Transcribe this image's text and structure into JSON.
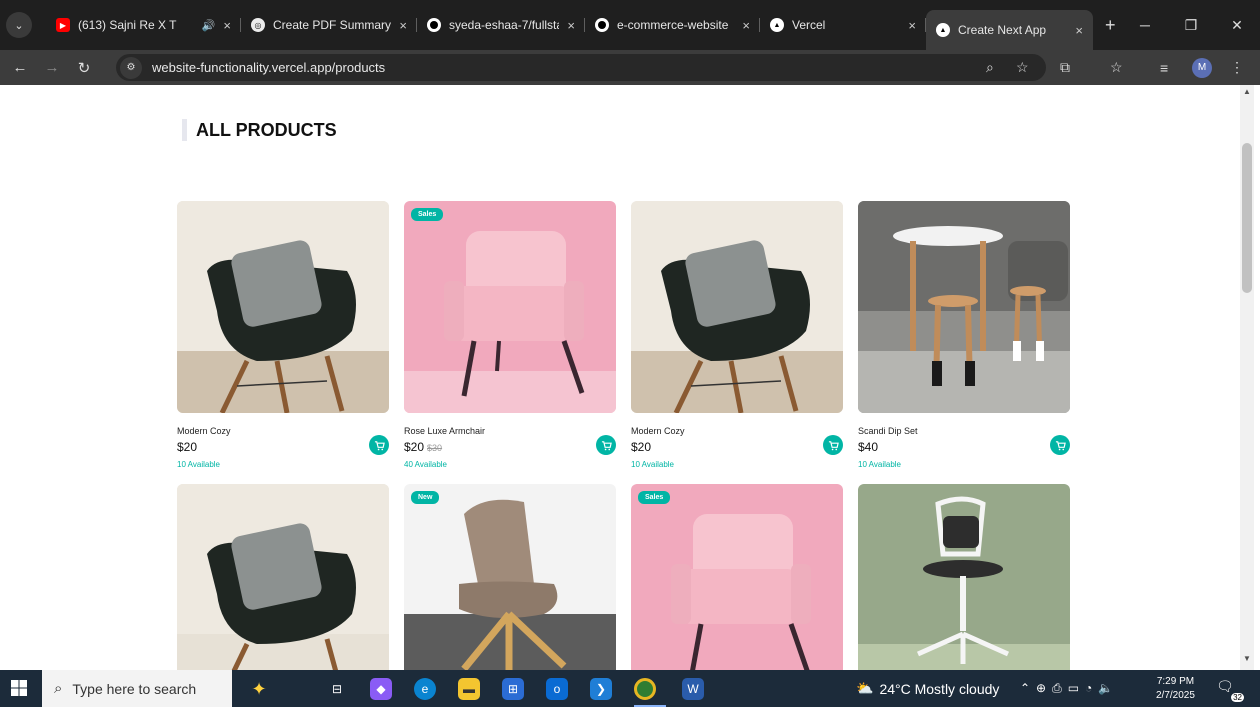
{
  "browser": {
    "tabs": [
      {
        "title": "(613) Sajni Re X T",
        "favicon": "youtube-icon",
        "color": "#ff0000",
        "has_audio": true
      },
      {
        "title": "Create PDF Summary",
        "favicon": "chatgpt-icon",
        "color": "#cccccc"
      },
      {
        "title": "syeda-eshaa-7/fullsta",
        "favicon": "github-icon",
        "color": "#ffffff"
      },
      {
        "title": "e-commerce-website",
        "favicon": "github-icon",
        "color": "#ffffff"
      },
      {
        "title": "Vercel",
        "favicon": "vercel-icon",
        "color": "#ffffff"
      },
      {
        "title": "Create Next App",
        "favicon": "vercel-icon",
        "color": "#ffffff",
        "active": true
      }
    ],
    "url": "website-functionality.vercel.app/products",
    "profile_initial": "M"
  },
  "page": {
    "heading": "ALL PRODUCTS",
    "products": [
      {
        "name": "Modern Cozy",
        "price": "$20",
        "old_price": "",
        "available": "10 Available",
        "badge": "",
        "image": "black-chair-with-pillow"
      },
      {
        "name": "Rose Luxe Armchair",
        "price": "$20",
        "old_price": "$30",
        "available": "40 Available",
        "badge": "Sales",
        "image": "pink-armchair"
      },
      {
        "name": "Modern Cozy",
        "price": "$20",
        "old_price": "",
        "available": "10 Available",
        "badge": "",
        "image": "black-chair-with-pillow"
      },
      {
        "name": "Scandi Dip Set",
        "price": "$40",
        "old_price": "",
        "available": "10 Available",
        "badge": "",
        "image": "wooden-stool-set"
      },
      {
        "name": "",
        "price": "",
        "old_price": "",
        "available": "",
        "badge": "",
        "image": "black-chair-with-pillow"
      },
      {
        "name": "",
        "price": "",
        "old_price": "",
        "available": "",
        "badge": "New",
        "image": "taupe-lounge-chair"
      },
      {
        "name": "",
        "price": "",
        "old_price": "",
        "available": "",
        "badge": "Sales",
        "image": "pink-armchair"
      },
      {
        "name": "",
        "price": "",
        "old_price": "",
        "available": "",
        "badge": "",
        "image": "white-desk-chair"
      }
    ],
    "accent_color": "#01b5a5"
  },
  "taskbar": {
    "search_placeholder": "Type here to search",
    "weather": "24°C  Mostly cloudy",
    "time": "7:29 PM",
    "date": "2/7/2025",
    "notification_count": "32"
  }
}
